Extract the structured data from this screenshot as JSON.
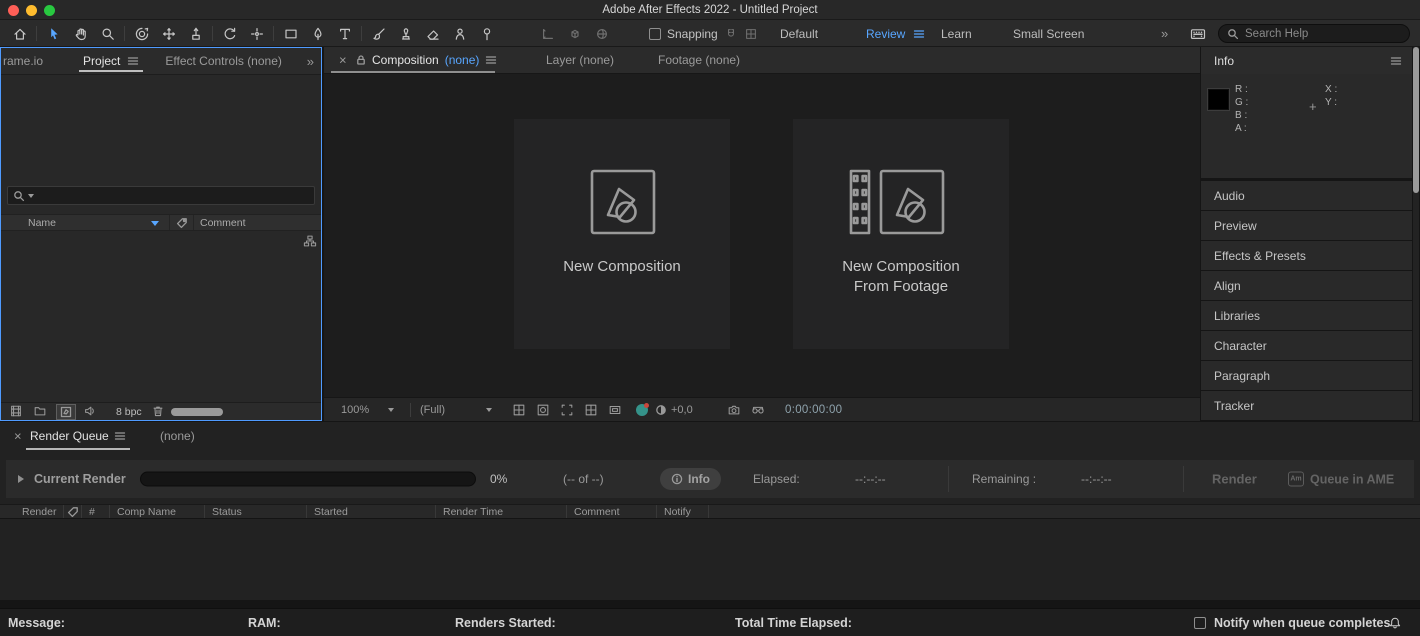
{
  "colors": {
    "accent_blue": "#58a6ff",
    "panel_focus_border": "#4f9bff",
    "traffic_red": "#ff5f57",
    "traffic_yellow": "#febc2e",
    "traffic_green": "#28c840",
    "panel_bg": "#282828",
    "viewer_bg": "#1d1d1d"
  },
  "window": {
    "title": "Adobe After Effects 2022 - Untitled Project"
  },
  "toolbar": {
    "tools": [
      "home-tool",
      "selection-tool",
      "hand-tool",
      "zoom-tool",
      "orbit-camera-tool",
      "pan-camera-tool",
      "dolly-camera-tool",
      "rotation-tool",
      "pan-behind-anchor-tool",
      "rectangle-tool",
      "pen-tool",
      "type-tool",
      "brush-tool",
      "clone-stamp-tool",
      "eraser-tool",
      "roto-brush-tool",
      "puppet-pin-tool"
    ],
    "aux_tools": [
      "local-axis-mode",
      "world-axis-mode",
      "view-axis-mode",
      "snap-to-edges",
      "snap-to-features"
    ],
    "snapping_label": "Snapping",
    "workspace_default": "Default",
    "workspace_review": "Review",
    "workspace_learn": "Learn",
    "workspace_small": "Small Screen",
    "workspace_overflow": "»",
    "search_placeholder": "Search Help"
  },
  "project": {
    "tab_frameio": "rame.io",
    "tab_project": "Project",
    "tab_effect_controls": "Effect Controls (none)",
    "tab_overflow": "»",
    "column_name": "Name",
    "column_comment": "Comment",
    "color_depth": "8 bpc"
  },
  "viewer": {
    "close": "×",
    "tab_composition": "Composition",
    "tab_composition_none": "(none)",
    "tab_layer": "Layer (none)",
    "tab_footage": "Footage (none)",
    "card_new_composition": "New Composition",
    "card_from_footage_line1": "New Composition",
    "card_from_footage_line2": "From Footage",
    "magnification": "100%",
    "resolution": "(Full)",
    "exposure": "+0,0",
    "timecode": "0:00:00:00"
  },
  "info": {
    "title": "Info",
    "r_label": "R :",
    "g_label": "G :",
    "b_label": "B :",
    "a_label": "A :",
    "x_label": "X :",
    "y_label": "Y :",
    "crosshair": "+"
  },
  "side_panels": [
    "Audio",
    "Preview",
    "Effects & Presets",
    "Align",
    "Libraries",
    "Character",
    "Paragraph",
    "Tracker"
  ],
  "render_queue": {
    "close": "×",
    "tab": "Render Queue",
    "secondary_tab": "(none)",
    "current_render_label": "Current Render",
    "progress_percent": "0%",
    "progress_of": "(-- of --)",
    "info_button": "Info",
    "elapsed_label": "Elapsed:",
    "elapsed_value": "--:--:--",
    "remaining_label": "Remaining :",
    "remaining_value": "--:--:--",
    "render_button": "Render",
    "queue_ame_button": "Queue in AME",
    "columns": [
      "Render",
      "#",
      "Comp Name",
      "Status",
      "Started",
      "Render Time",
      "Comment",
      "Notify"
    ]
  },
  "status_bar": {
    "message_label": "Message:",
    "ram_label": "RAM:",
    "renders_started_label": "Renders Started:",
    "total_time_label": "Total Time Elapsed:",
    "notify_checkbox_label": "Notify when queue completes"
  }
}
